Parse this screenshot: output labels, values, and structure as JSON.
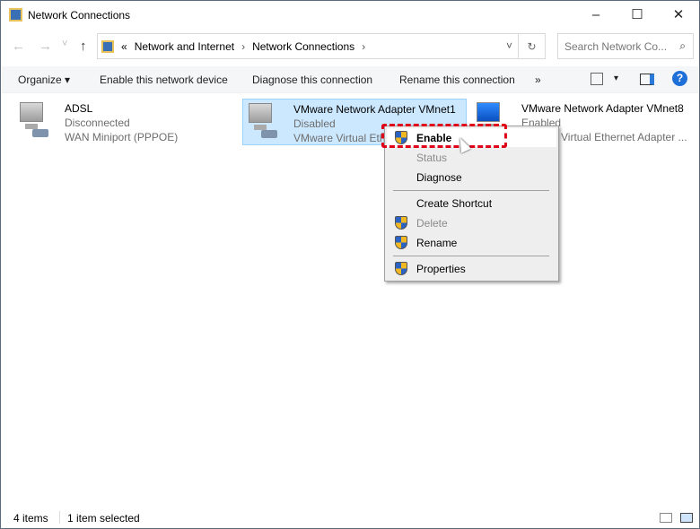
{
  "window": {
    "title": "Network Connections",
    "minimize": "–",
    "maximize": "☐",
    "close": "✕"
  },
  "address": {
    "back": "←",
    "forward": "→",
    "recent": "˅",
    "up": "↑",
    "overflow": "«",
    "crumbs": [
      "Network and Internet",
      "Network Connections"
    ],
    "sep": "›",
    "dropdown": "˅",
    "refresh": "↻"
  },
  "search": {
    "placeholder": "Search Network Co...",
    "icon": "⌕"
  },
  "toolbar": {
    "organize": "Organize ▾",
    "enable": "Enable this network device",
    "diagnose": "Diagnose this connection",
    "rename": "Rename this connection",
    "more": "»",
    "view": "▾",
    "help": "?"
  },
  "items": [
    {
      "name": "ADSL",
      "status": "Disconnected",
      "device": "WAN Miniport (PPPOE)"
    },
    {
      "name": "VMware Network Adapter VMnet1",
      "status": "Disabled",
      "device": "VMware Virtual Eth"
    },
    {
      "name": "VMware Network Adapter VMnet8",
      "status": "Enabled",
      "device": "Virtual Ethernet Adapter ..."
    }
  ],
  "context_menu": {
    "enable": "Enable",
    "status": "Status",
    "diagnose": "Diagnose",
    "create_shortcut": "Create Shortcut",
    "delete": "Delete",
    "rename": "Rename",
    "properties": "Properties"
  },
  "statusbar": {
    "count": "4 items",
    "selected": "1 item selected"
  }
}
